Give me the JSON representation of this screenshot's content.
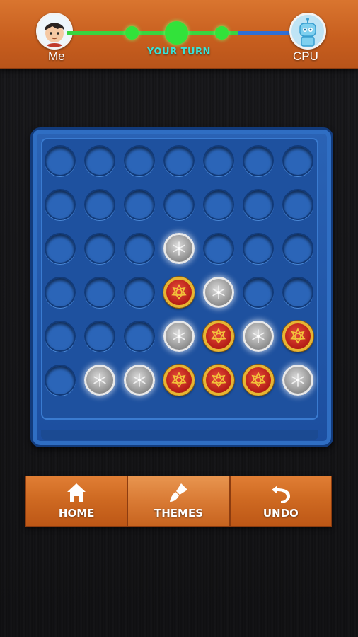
{
  "header": {
    "player1": {
      "name": "Me",
      "avatar_icon": "boy-avatar-icon"
    },
    "player2": {
      "name": "CPU",
      "avatar_icon": "robot-avatar-icon"
    },
    "turn_text": "YOUR TURN"
  },
  "board": {
    "rows": 6,
    "cols": 7,
    "cells": [
      [
        "empty",
        "empty",
        "empty",
        "empty",
        "empty",
        "empty",
        "empty"
      ],
      [
        "empty",
        "empty",
        "empty",
        "empty",
        "empty",
        "empty",
        "empty"
      ],
      [
        "empty",
        "empty",
        "empty",
        "silver",
        "empty",
        "empty",
        "empty"
      ],
      [
        "empty",
        "empty",
        "empty",
        "red",
        "silver",
        "empty",
        "empty"
      ],
      [
        "empty",
        "empty",
        "empty",
        "silver",
        "red",
        "silver",
        "red"
      ],
      [
        "empty",
        "silver",
        "silver",
        "red",
        "red",
        "red",
        "silver"
      ]
    ],
    "colors": {
      "board": "#1e519f",
      "red_disc": "#b41d16",
      "gold_rim": "#e7b531",
      "silver_disc": "#9a9a9a"
    }
  },
  "buttons": {
    "home": {
      "label": "HOME",
      "icon": "home-icon"
    },
    "themes": {
      "label": "THEMES",
      "icon": "paintbrush-icon"
    },
    "undo": {
      "label": "UNDO",
      "icon": "undo-icon"
    }
  }
}
